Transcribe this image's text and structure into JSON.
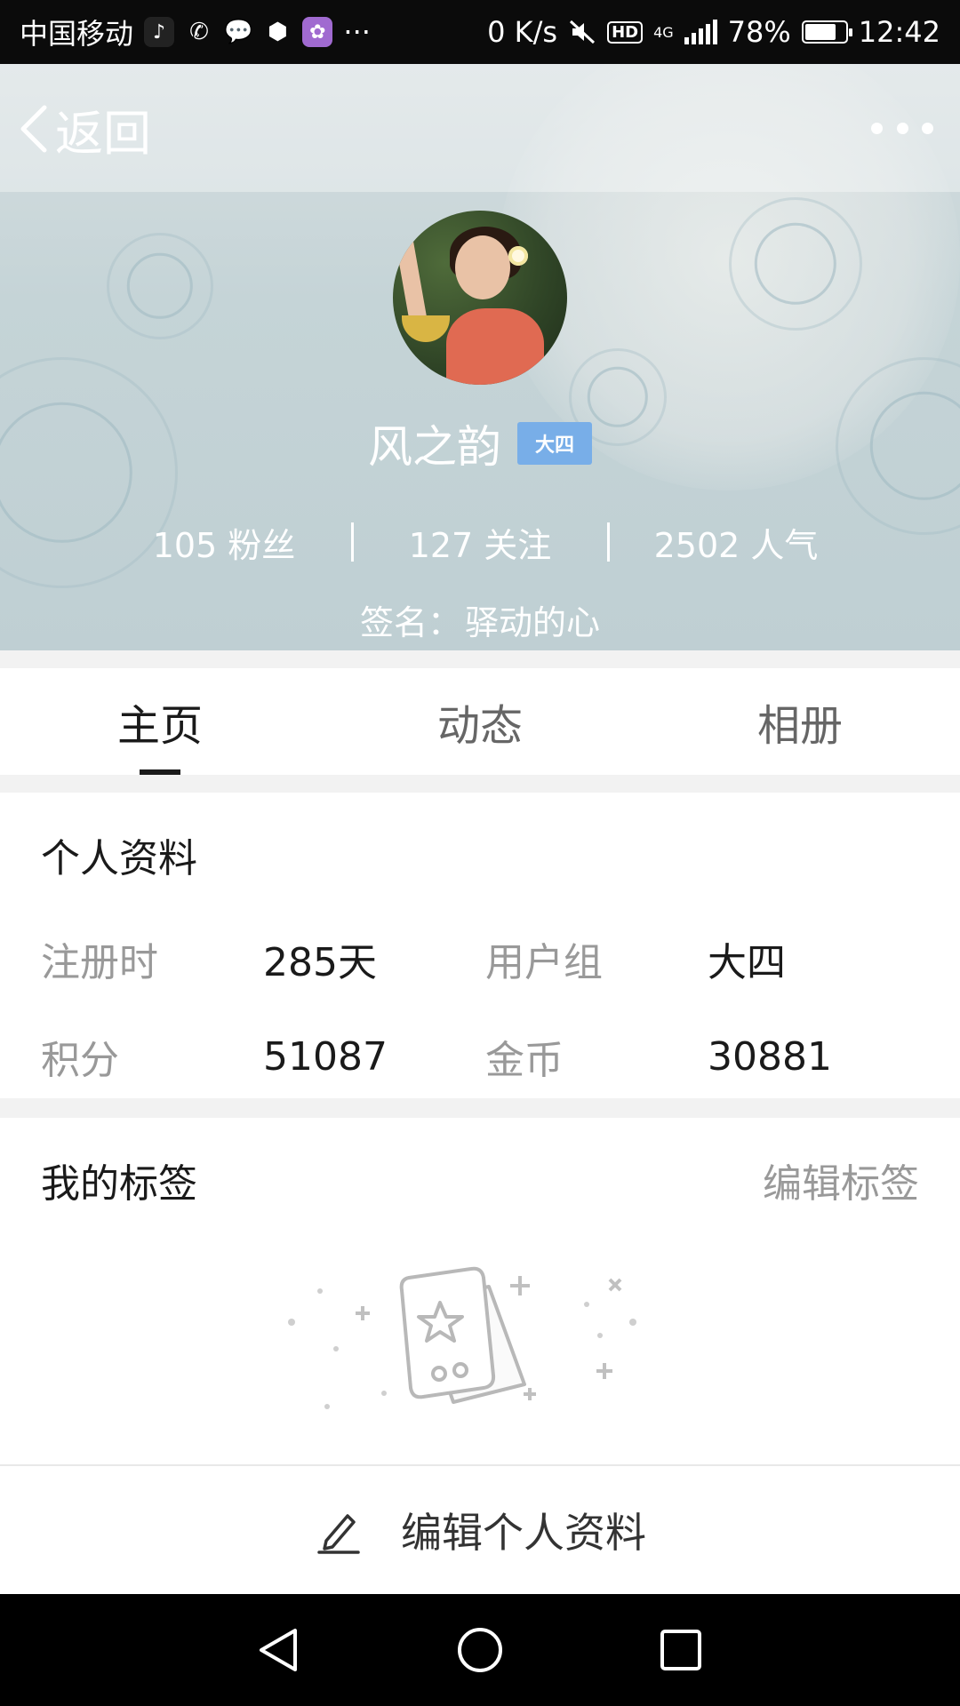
{
  "status_bar": {
    "carrier": "中国移动",
    "more": "···",
    "net_speed": "0 K/s",
    "hd": "HD",
    "network": "4G",
    "battery": "78%",
    "battery_level": 0.78,
    "time": "12:42"
  },
  "header": {
    "back_label": "返回",
    "username": "风之韵",
    "level": "大四",
    "stats": [
      "105 粉丝",
      "127 关注",
      "2502 人气"
    ],
    "signature_label": "签名：",
    "signature": "驿动的心"
  },
  "tabs": [
    {
      "label": "主页",
      "active": true
    },
    {
      "label": "动态",
      "active": false
    },
    {
      "label": "相册",
      "active": false
    }
  ],
  "profile": {
    "title": "个人资料",
    "rows": [
      [
        {
          "label": "注册时",
          "value": "285天"
        },
        {
          "label": "用户组",
          "value": "大四"
        }
      ],
      [
        {
          "label": "积分",
          "value": "51087"
        },
        {
          "label": "金币",
          "value": "30881"
        }
      ]
    ]
  },
  "tags": {
    "title": "我的标签",
    "edit_label": "编辑标签"
  },
  "edit_profile_label": "编辑个人资料",
  "colors": {
    "badge": "#78aee8",
    "banner": "#c5d4d7",
    "active_tab": "#1a1a1a"
  }
}
